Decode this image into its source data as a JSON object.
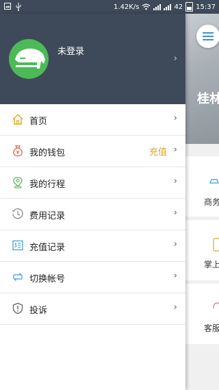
{
  "status_bar": {
    "speed": "1.42K/s",
    "battery": "42",
    "time": "15:37"
  },
  "drawer": {
    "login_text": "未登录",
    "items": [
      {
        "label": "首页",
        "icon": "home-icon",
        "badge": ""
      },
      {
        "label": "我的钱包",
        "icon": "wallet-icon",
        "badge": "充值"
      },
      {
        "label": "我的行程",
        "icon": "location-pin-icon",
        "badge": ""
      },
      {
        "label": "费用记录",
        "icon": "clock-icon",
        "badge": ""
      },
      {
        "label": "充值记录",
        "icon": "receipt-icon",
        "badge": ""
      },
      {
        "label": "切换帐号",
        "icon": "switch-account-icon",
        "badge": ""
      },
      {
        "label": "投诉",
        "icon": "alert-icon",
        "badge": ""
      }
    ]
  },
  "main": {
    "title": "桂林",
    "cards": [
      "商务",
      "掌上",
      "客服"
    ]
  },
  "colors": {
    "header_bg": "#3e4a5a",
    "avatar_bg": "#4cba57",
    "badge": "#e0a21a",
    "icon_accent": "#e6a817"
  }
}
